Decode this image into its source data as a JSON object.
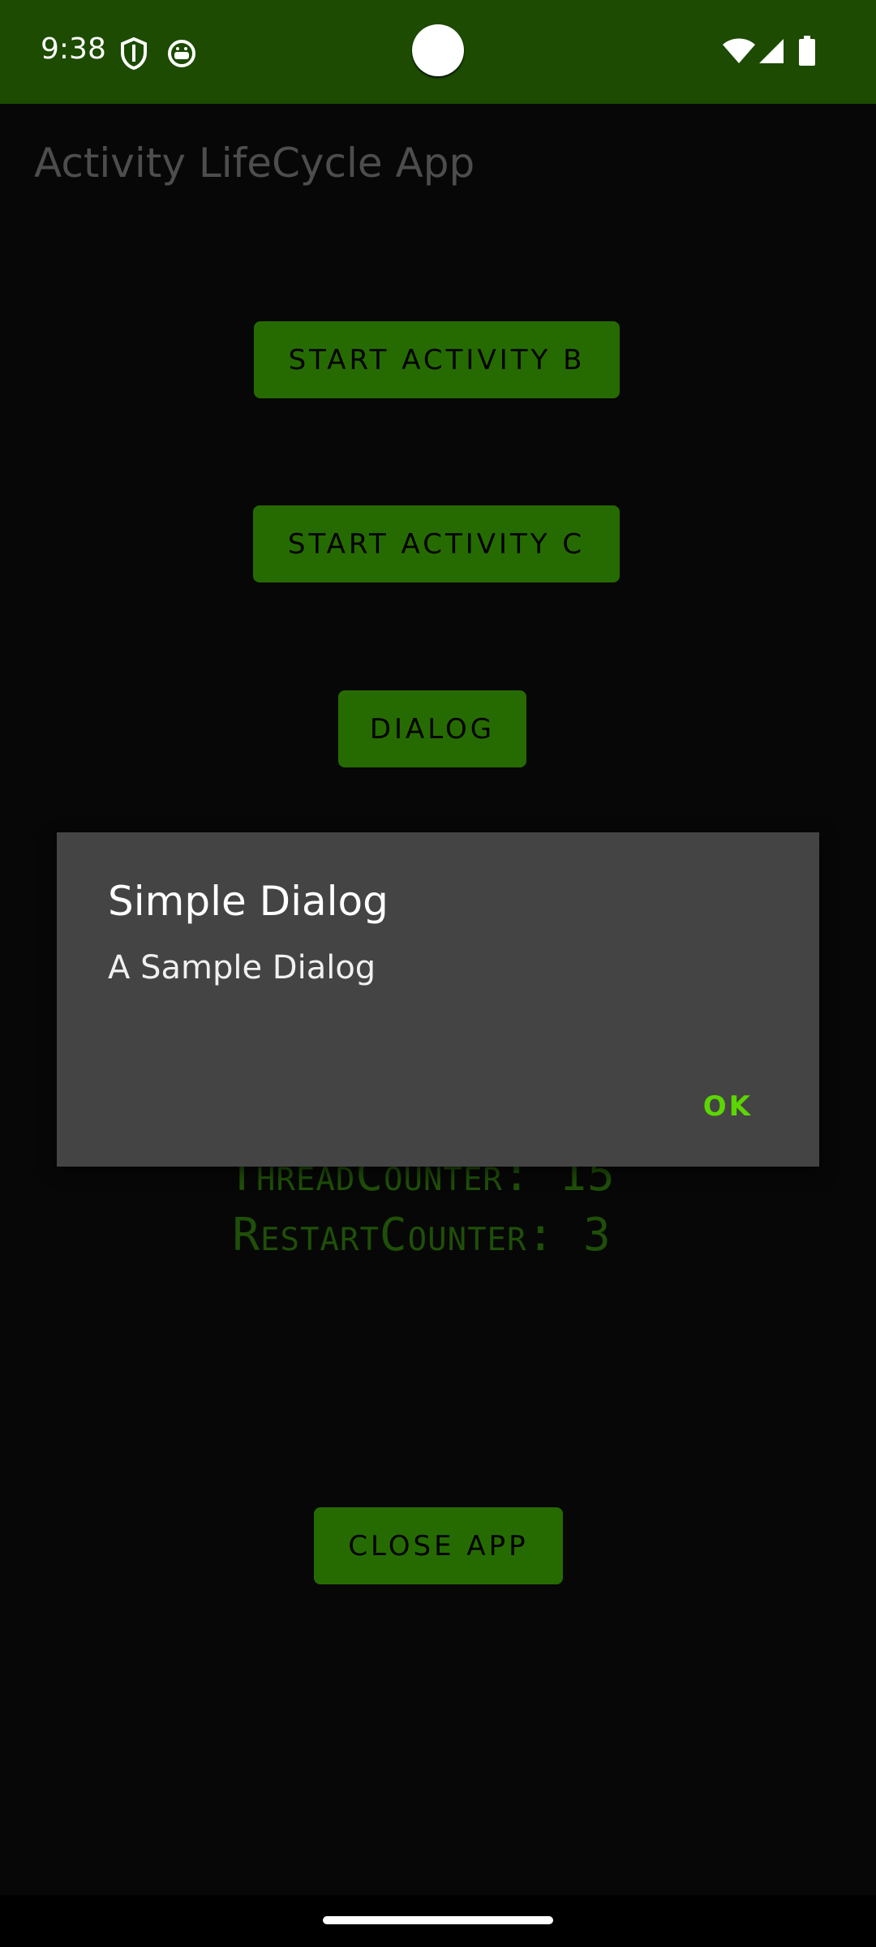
{
  "status_bar": {
    "time": "9:38",
    "background": "#1c4b01",
    "left_icons": [
      "shield-icon",
      "android-bot-icon"
    ],
    "right_icons": [
      "wifi-icon",
      "cellular-signal-icon",
      "battery-icon"
    ]
  },
  "app": {
    "title": "Activity LifeCycle App",
    "buttons": {
      "start_activity_b": "START ACTIVITY B",
      "start_activity_c": "START ACTIVITY C",
      "dialog": "DIALOG",
      "close_app": "CLOSE APP"
    },
    "counters": {
      "thread_counter": "ThreadCounter: 15",
      "restart_counter": "RestartCounter: 3"
    },
    "accent_color": "#266b01"
  },
  "dialog": {
    "title": "Simple Dialog",
    "message": "A Sample Dialog",
    "ok_label": "OK",
    "ok_color": "#5cd600",
    "background": "#444444"
  }
}
